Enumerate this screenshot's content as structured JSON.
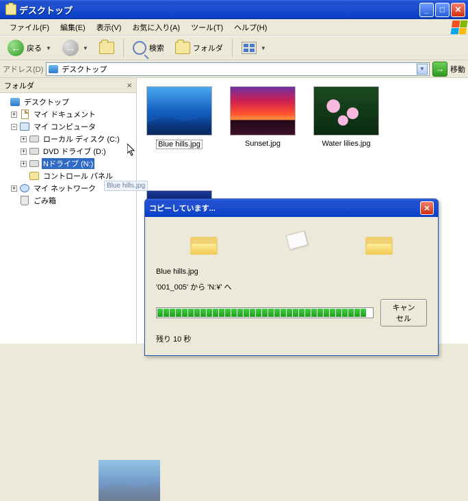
{
  "window": {
    "title": "デスクトップ",
    "min": "_",
    "max": "□",
    "close": "✕"
  },
  "menu": {
    "file": "ファイル(F)",
    "edit": "編集(E)",
    "view": "表示(V)",
    "favorites": "お気に入り(A)",
    "tools": "ツール(T)",
    "help": "ヘルプ(H)"
  },
  "toolbar": {
    "back": "戻る",
    "search": "検索",
    "folders": "フォルダ"
  },
  "address": {
    "label": "アドレス(D)",
    "value": "デスクトップ",
    "go": "移動"
  },
  "sidebar": {
    "title": "フォルダ",
    "close": "×",
    "nodes": {
      "desktop": "デスクトップ",
      "mydocs": "マイ ドキュメント",
      "mycomp": "マイ コンピュータ",
      "localc": "ローカル ディスク (C:)",
      "dvdd": "DVD ドライブ (D:)",
      "ndrive": "Nドライブ (N:)",
      "cpanel": "コントロール パネル",
      "mynet": "マイ ネットワーク",
      "recycle": "ごみ箱"
    }
  },
  "thumbs": [
    {
      "caption": "Blue hills.jpg"
    },
    {
      "caption": "Sunset.jpg"
    },
    {
      "caption": "Water lilies.jpg"
    }
  ],
  "drag": {
    "label": "Blue hills.jpg"
  },
  "dialog": {
    "title": "コピーしています...",
    "filename": "Blue hills.jpg",
    "from_to": "'001_005' から 'N:¥' へ",
    "remaining": "残り 10 秒",
    "cancel": "キャンセル",
    "close": "✕"
  }
}
